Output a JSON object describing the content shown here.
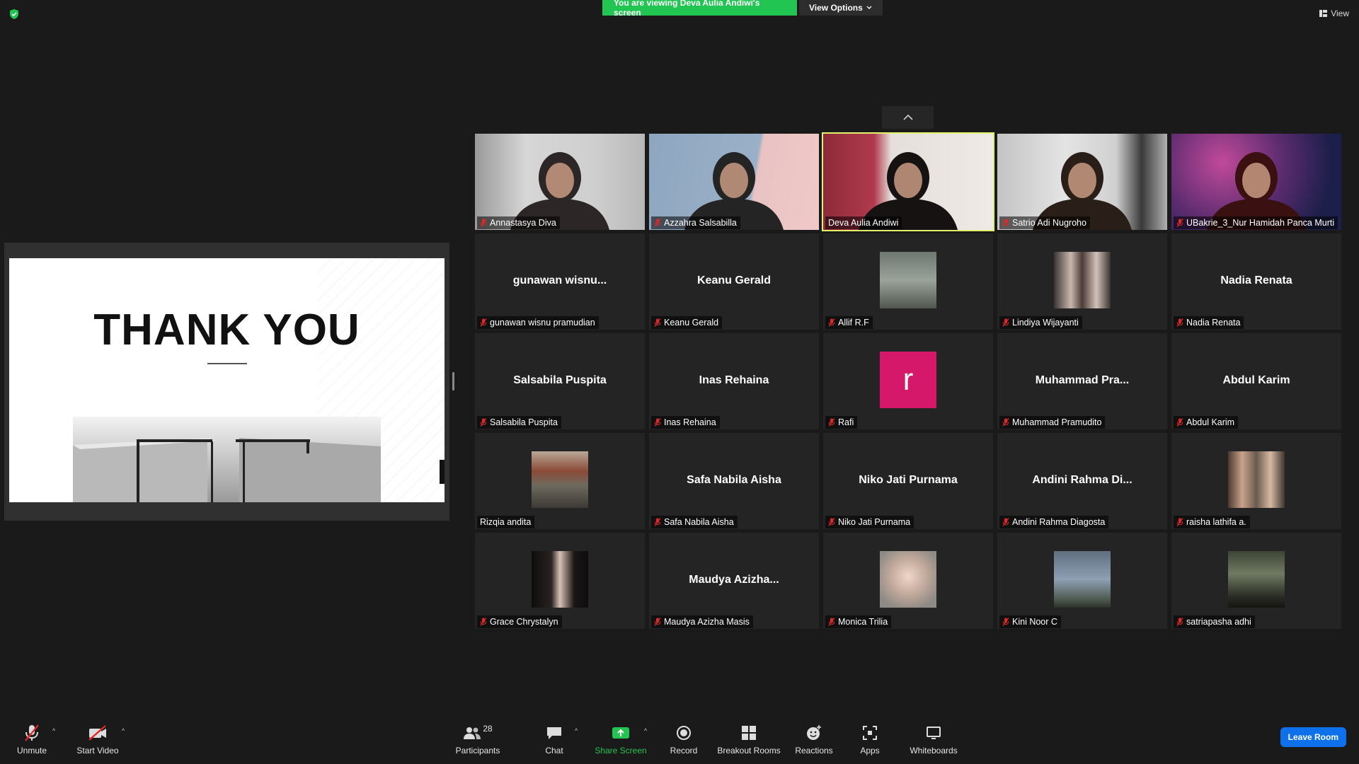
{
  "banner": {
    "viewing_text": "You are viewing Deva Aulia Andiwi's screen",
    "view_options_label": "View Options",
    "view_label": "View"
  },
  "slide": {
    "title": "THANK YOU"
  },
  "tiles": [
    {
      "name": "Annastasya Diva",
      "muted": true,
      "kind": "video",
      "bg": "linear-gradient(90deg,#9a9a9a,#d6d6d6 30%,#cfcfcf 70%,#b8b8b8)",
      "person": "#2d2626"
    },
    {
      "name": "Azzahra Salsabilla",
      "muted": true,
      "kind": "video",
      "bg": "linear-gradient(100deg,#8fa6c0 0%,#9ab0c8 60%,#e9c3c3 62%,#f0c8c8 100%)",
      "person": "#242424"
    },
    {
      "name": "Deva Aulia Andiwi",
      "muted": false,
      "active": true,
      "kind": "video",
      "bg": "linear-gradient(90deg,#8e2a3a 0%,#b03a4c 30%,#e5dfdb 40%,#efeae6 100%)",
      "person": "#161212"
    },
    {
      "name": "Satrio Adi Nugroho",
      "muted": true,
      "kind": "video",
      "bg": "linear-gradient(90deg,#c4c4c4,#e4e4e4 40%,#d0d0d0 70%,#3a3a3a 85%,#b0b0b0)",
      "person": "#2a1e18"
    },
    {
      "name": "UBakrie_3_Nur Hamidah Panca Murti",
      "muted": true,
      "kind": "video",
      "bg": "radial-gradient(circle at 30% 30%,#c14a9a,#5a2b6e 45%,#1c1f4a 80%)",
      "person": "#3a1010"
    },
    {
      "name": "gunawan wisnu pramudian",
      "label": "gunawan  wisnu...",
      "muted": true,
      "kind": "text"
    },
    {
      "name": "Keanu Gerald",
      "label": "Keanu Gerald",
      "muted": true,
      "kind": "text"
    },
    {
      "name": "Allif R.F",
      "muted": true,
      "kind": "thumb",
      "thumb": "linear-gradient(180deg,#6e7770,#9aa39a 50%,#51574f)"
    },
    {
      "name": "Lindiya Wijayanti",
      "muted": true,
      "kind": "thumb",
      "thumb": "linear-gradient(90deg,#3b3434,#c8b7ae 30%,#4a3c38 50%,#d2c2b8 75%,#3b3434)"
    },
    {
      "name": "Nadia Renata",
      "label": "Nadia Renata",
      "muted": true,
      "kind": "text"
    },
    {
      "name": "Salsabila Puspita",
      "label": "Salsabila Puspita",
      "muted": true,
      "kind": "text"
    },
    {
      "name": "Inas Rehaina",
      "label": "Inas Rehaina",
      "muted": true,
      "kind": "text"
    },
    {
      "name": "Rafi",
      "muted": true,
      "kind": "letter",
      "letter": "r",
      "color": "#d6186b"
    },
    {
      "name": "Muhammad Pramudito",
      "label": "Muhammad  Pra...",
      "muted": true,
      "kind": "text"
    },
    {
      "name": "Abdul Karim",
      "label": "Abdul Karim",
      "muted": true,
      "kind": "text"
    },
    {
      "name": "Rizqia andita",
      "muted": false,
      "kind": "thumb",
      "thumb": "linear-gradient(180deg,#b9a796,#8b4a36 35%,#6f6a5e 60%,#3d3a36)"
    },
    {
      "name": "Safa Nabila Aisha",
      "label": "Safa Nabila Aisha",
      "muted": true,
      "kind": "text"
    },
    {
      "name": "Niko Jati Purnama",
      "label": "Niko Jati Purnama",
      "muted": true,
      "kind": "text"
    },
    {
      "name": "Andini Rahma Diagosta",
      "label": "Andini  Rahma  Di...",
      "muted": true,
      "kind": "text"
    },
    {
      "name": "raisha lathifa a.",
      "muted": true,
      "kind": "thumb",
      "thumb": "linear-gradient(90deg,#4a3a30,#c9a38a 25%,#6a5a50 50%,#d7b9a3 75%,#3e3530)"
    },
    {
      "name": "Grace Chrystalyn",
      "muted": true,
      "kind": "thumb",
      "thumb": "linear-gradient(90deg,#0d0d0d,#2a2222 35%,#d8c2b6 50%,#1b1616 75%,#0d0d0d)"
    },
    {
      "name": "Maudya Azizha Masis",
      "label": "Maudya  Azizha...",
      "muted": true,
      "kind": "text"
    },
    {
      "name": "Monica Trilia",
      "muted": true,
      "kind": "thumb",
      "thumb": "radial-gradient(circle at 50% 45%,#f1d6c8,#bfa79a 45%,#8e8a86 80%)"
    },
    {
      "name": "Kini Noor C",
      "muted": true,
      "kind": "thumb",
      "thumb": "linear-gradient(180deg,#5f6f80,#8ea0b3 50%,#4e5a50 85%,#2c3229)"
    },
    {
      "name": "satriapasha adhi",
      "muted": true,
      "kind": "thumb",
      "thumb": "linear-gradient(180deg,#3d4436,#6f7a62 40%,#2a2d25 80%,#14150f)"
    }
  ],
  "toolbar": {
    "unmute": "Unmute",
    "start_video": "Start Video",
    "participants": "Participants",
    "participants_count": "28",
    "chat": "Chat",
    "share_screen": "Share Screen",
    "record": "Record",
    "breakout_rooms": "Breakout Rooms",
    "reactions": "Reactions",
    "apps": "Apps",
    "whiteboards": "Whiteboards",
    "leave": "Leave Room"
  },
  "colors": {
    "share_green": "#23c552",
    "active_speaker": "#e2f26b",
    "leave_blue": "#0e71eb",
    "muted_red": "#e02828"
  }
}
